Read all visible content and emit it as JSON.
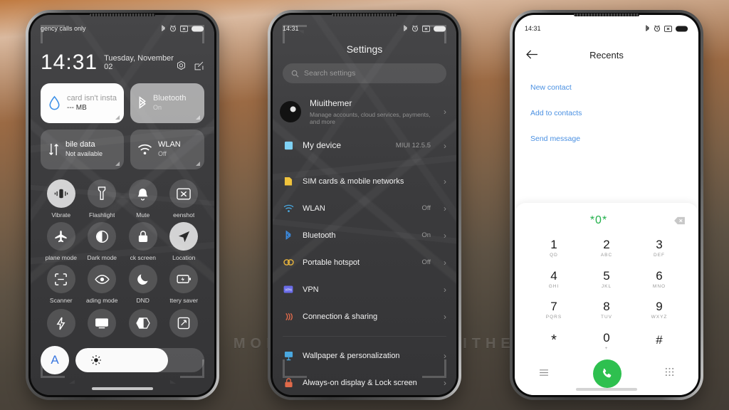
{
  "background": {
    "top_color": "#c07a40",
    "bottom_color": "#423c35"
  },
  "watermark": {
    "text": "VISIT  FOR  MORE  THEMES  -  MIUITHEMER.COM"
  },
  "phone1": {
    "status_bar": {
      "carrier": "gency calls only",
      "icons": [
        "bluetooth-icon",
        "alarm-icon",
        "screenshot-icon",
        "battery-icon"
      ]
    },
    "clock": {
      "time": "14:31",
      "date": "Tuesday, November 02"
    },
    "header_icons": [
      "settings-gear-icon",
      "edit-icon"
    ],
    "big_tiles": [
      {
        "title": "card isn't insta",
        "sub": "--- MB",
        "icon": "water-drop-icon",
        "state": "on-white"
      },
      {
        "title": "Bluetooth",
        "sub": "On",
        "icon": "bluetooth-icon",
        "state": "bt-mid"
      },
      {
        "title": "bile data",
        "sub": "Not available",
        "icon": "mobile-data-icon",
        "state": "off"
      },
      {
        "title": "WLAN",
        "sub": "Off",
        "icon": "wifi-icon",
        "state": "off"
      }
    ],
    "toggles": [
      {
        "label": "Vibrate",
        "icon": "vibrate-icon",
        "active": true
      },
      {
        "label": "Flashlight",
        "icon": "flashlight-icon",
        "active": false
      },
      {
        "label": "Mute",
        "icon": "bell-icon",
        "active": false
      },
      {
        "label": "eenshot",
        "icon": "screenshot-icon",
        "active": false
      },
      {
        "label": "plane mode",
        "icon": "airplane-icon",
        "active": false
      },
      {
        "label": "Dark mode",
        "icon": "dark-mode-icon",
        "active": false
      },
      {
        "label": "ck screen",
        "icon": "lock-icon",
        "active": false
      },
      {
        "label": "Location",
        "icon": "location-icon",
        "active": true
      },
      {
        "label": "Scanner",
        "icon": "scanner-icon",
        "active": false
      },
      {
        "label": "ading mode",
        "icon": "eye-icon",
        "active": false
      },
      {
        "label": "DND",
        "icon": "moon-icon",
        "active": false
      },
      {
        "label": "ttery saver",
        "icon": "battery-saver-icon",
        "active": false
      }
    ],
    "toggles_last_row": [
      {
        "label": "",
        "icon": "lightning-icon"
      },
      {
        "label": "",
        "icon": "cast-icon"
      },
      {
        "label": "",
        "icon": "theme-icon"
      },
      {
        "label": "",
        "icon": "rotate-icon"
      }
    ],
    "brightness": {
      "auto_label": "A",
      "icon": "brightness-icon",
      "level_percent": 72
    }
  },
  "phone2": {
    "status_bar": {
      "time": "14:31",
      "icons": [
        "bluetooth-icon",
        "alarm-icon",
        "screenshot-icon",
        "battery-icon"
      ]
    },
    "title": "Settings",
    "search": {
      "placeholder": "Search settings",
      "icon": "search-icon"
    },
    "account": {
      "name": "Miuithemer",
      "sub": "Manage accounts, cloud services, payments, and more",
      "icon": "avatar"
    },
    "device": {
      "label": "My device",
      "value": "MIUI 12.5.5",
      "icon": "device-icon",
      "color": "#7fd2f5"
    },
    "group_network": [
      {
        "label": "SIM cards & mobile networks",
        "value": "",
        "icon": "sim-icon",
        "color": "#f0c33c"
      },
      {
        "label": "WLAN",
        "value": "Off",
        "icon": "wifi-icon",
        "color": "#4aa8e0"
      },
      {
        "label": "Bluetooth",
        "value": "On",
        "icon": "bluetooth-icon",
        "color": "#3b8fe8"
      },
      {
        "label": "Portable hotspot",
        "value": "Off",
        "icon": "hotspot-icon",
        "color": "#e8b43c"
      },
      {
        "label": "VPN",
        "value": "",
        "icon": "vpn-icon",
        "color": "#6a6ce8"
      },
      {
        "label": "Connection & sharing",
        "value": "",
        "icon": "connection-icon",
        "color": "#e06a4a"
      }
    ],
    "group_personal": [
      {
        "label": "Wallpaper & personalization",
        "value": "",
        "icon": "wallpaper-icon",
        "color": "#4aa8e0"
      },
      {
        "label": "Always-on display & Lock screen",
        "value": "",
        "icon": "lock-icon",
        "color": "#e06a4a"
      }
    ]
  },
  "phone3": {
    "status_bar": {
      "time": "14:31",
      "icons": [
        "bluetooth-icon",
        "alarm-icon",
        "screenshot-icon",
        "battery-icon"
      ]
    },
    "title": "Recents",
    "back_icon": "back-arrow-icon",
    "actions": [
      "New contact",
      "Add to contacts",
      "Send message"
    ],
    "dialpad": {
      "number": "*0*",
      "number_color": "#22b04b",
      "delete_icon": "backspace-icon",
      "keys": [
        {
          "digit": "1",
          "sub": "QD"
        },
        {
          "digit": "2",
          "sub": "ABC"
        },
        {
          "digit": "3",
          "sub": "DEF"
        },
        {
          "digit": "4",
          "sub": "GHI"
        },
        {
          "digit": "5",
          "sub": "JKL"
        },
        {
          "digit": "6",
          "sub": "MNO"
        },
        {
          "digit": "7",
          "sub": "PQRS"
        },
        {
          "digit": "8",
          "sub": "TUV"
        },
        {
          "digit": "9",
          "sub": "WXYZ"
        },
        {
          "digit": "*",
          "sub": ""
        },
        {
          "digit": "0",
          "sub": "+"
        },
        {
          "digit": "#",
          "sub": ""
        }
      ],
      "bottom": {
        "left_icon": "menu-icon",
        "call_icon": "phone-icon",
        "right_icon": "keypad-icon",
        "call_color": "#2ec04f"
      }
    }
  }
}
